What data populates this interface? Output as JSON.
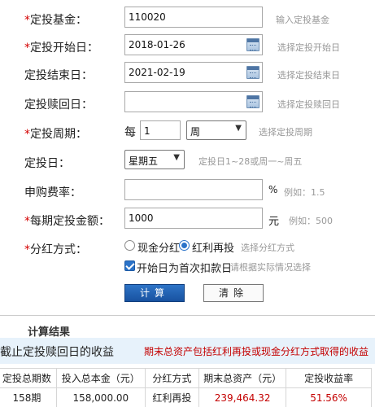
{
  "form": {
    "fund": {
      "label": "定投基金：",
      "value": "110020",
      "hint": "输入定投基金"
    },
    "start_date": {
      "label": "定投开始日：",
      "value": "2018-01-26",
      "hint": "选择定投开始日"
    },
    "end_date": {
      "label": "定投结束日：",
      "value": "2021-02-19",
      "hint": "选择定投结束日"
    },
    "redeem_date": {
      "label": "定投赎回日：",
      "value": "",
      "hint": "选择定投赎回日"
    },
    "period": {
      "label": "定投周期：",
      "prefix": "每",
      "value": "1",
      "unit_select": "周",
      "hint": "选择定投周期"
    },
    "day": {
      "label": "定投日：",
      "select": "星期五",
      "hint": "定投日1~28或周一~周五"
    },
    "fee": {
      "label": "申购费率：",
      "value": "",
      "unit": "%",
      "hint": "例如：1.5"
    },
    "amount": {
      "label": "每期定投金额：",
      "value": "1000",
      "unit": "元",
      "hint": "例如：500"
    },
    "dividend": {
      "label": "分红方式：",
      "option_cash": "现金分红",
      "option_reinvest": "红利再投",
      "selected": "红利再投",
      "hint": "选择分红方式"
    },
    "first_day": {
      "label": "开始日为首次扣款日",
      "checked": true,
      "hint": "请根据实际情况选择"
    },
    "calc_button": "计算",
    "clear_button": "清除"
  },
  "results": {
    "title": "计算结果",
    "banner_left": "截止定投赎回日的收益",
    "banner_right": "期末总资产包括红利再投或现金分红方式取得的收益",
    "headers": [
      "定投总期数",
      "投入总本金（元）",
      "分红方式",
      "期末总资产（元）",
      "定投收益率"
    ],
    "row": [
      "158期",
      "158,000.00",
      "红利再投",
      "239,464.32",
      "51.56%"
    ]
  },
  "colors": {
    "required": "#d40000",
    "accent": "#2b73c9",
    "result_red": "#c40000",
    "banner_bg": "#e7f2fb"
  },
  "icons": [
    "calendar-icon",
    "chevron-down-icon",
    "radio-icon",
    "checkbox-icon"
  ]
}
